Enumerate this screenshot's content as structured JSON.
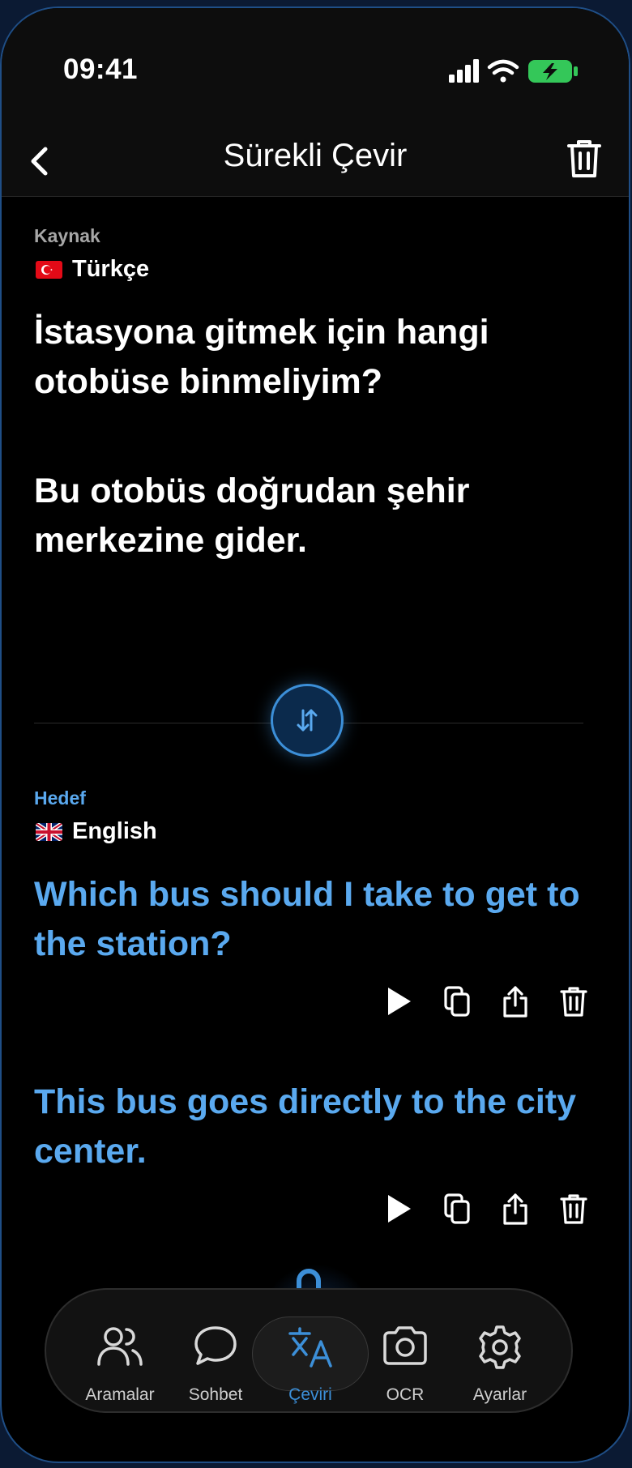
{
  "status_bar": {
    "time": "09:41"
  },
  "header": {
    "title": "Sürekli Çevir"
  },
  "source": {
    "label": "Kaynak",
    "language": "Türkçe",
    "sentences": [
      "İstasyona gitmek için hangi otobüse binmeliyim?",
      "Bu otobüs doğrudan şehir merkezine gider."
    ]
  },
  "target": {
    "label": "Hedef",
    "language": "English",
    "sentences": [
      "Which bus should I take to get to the station?",
      "This bus goes directly to the city center."
    ]
  },
  "tabs": [
    {
      "label": "Aramalar",
      "icon": "people-icon"
    },
    {
      "label": "Sohbet",
      "icon": "chat-bubble-icon"
    },
    {
      "label": "Çeviri",
      "icon": "translate-icon",
      "active": true
    },
    {
      "label": "OCR",
      "icon": "camera-icon"
    },
    {
      "label": "Ayarlar",
      "icon": "gear-icon"
    }
  ],
  "colors": {
    "accent": "#5aa9ef",
    "background": "#000000",
    "battery": "#34c759"
  }
}
